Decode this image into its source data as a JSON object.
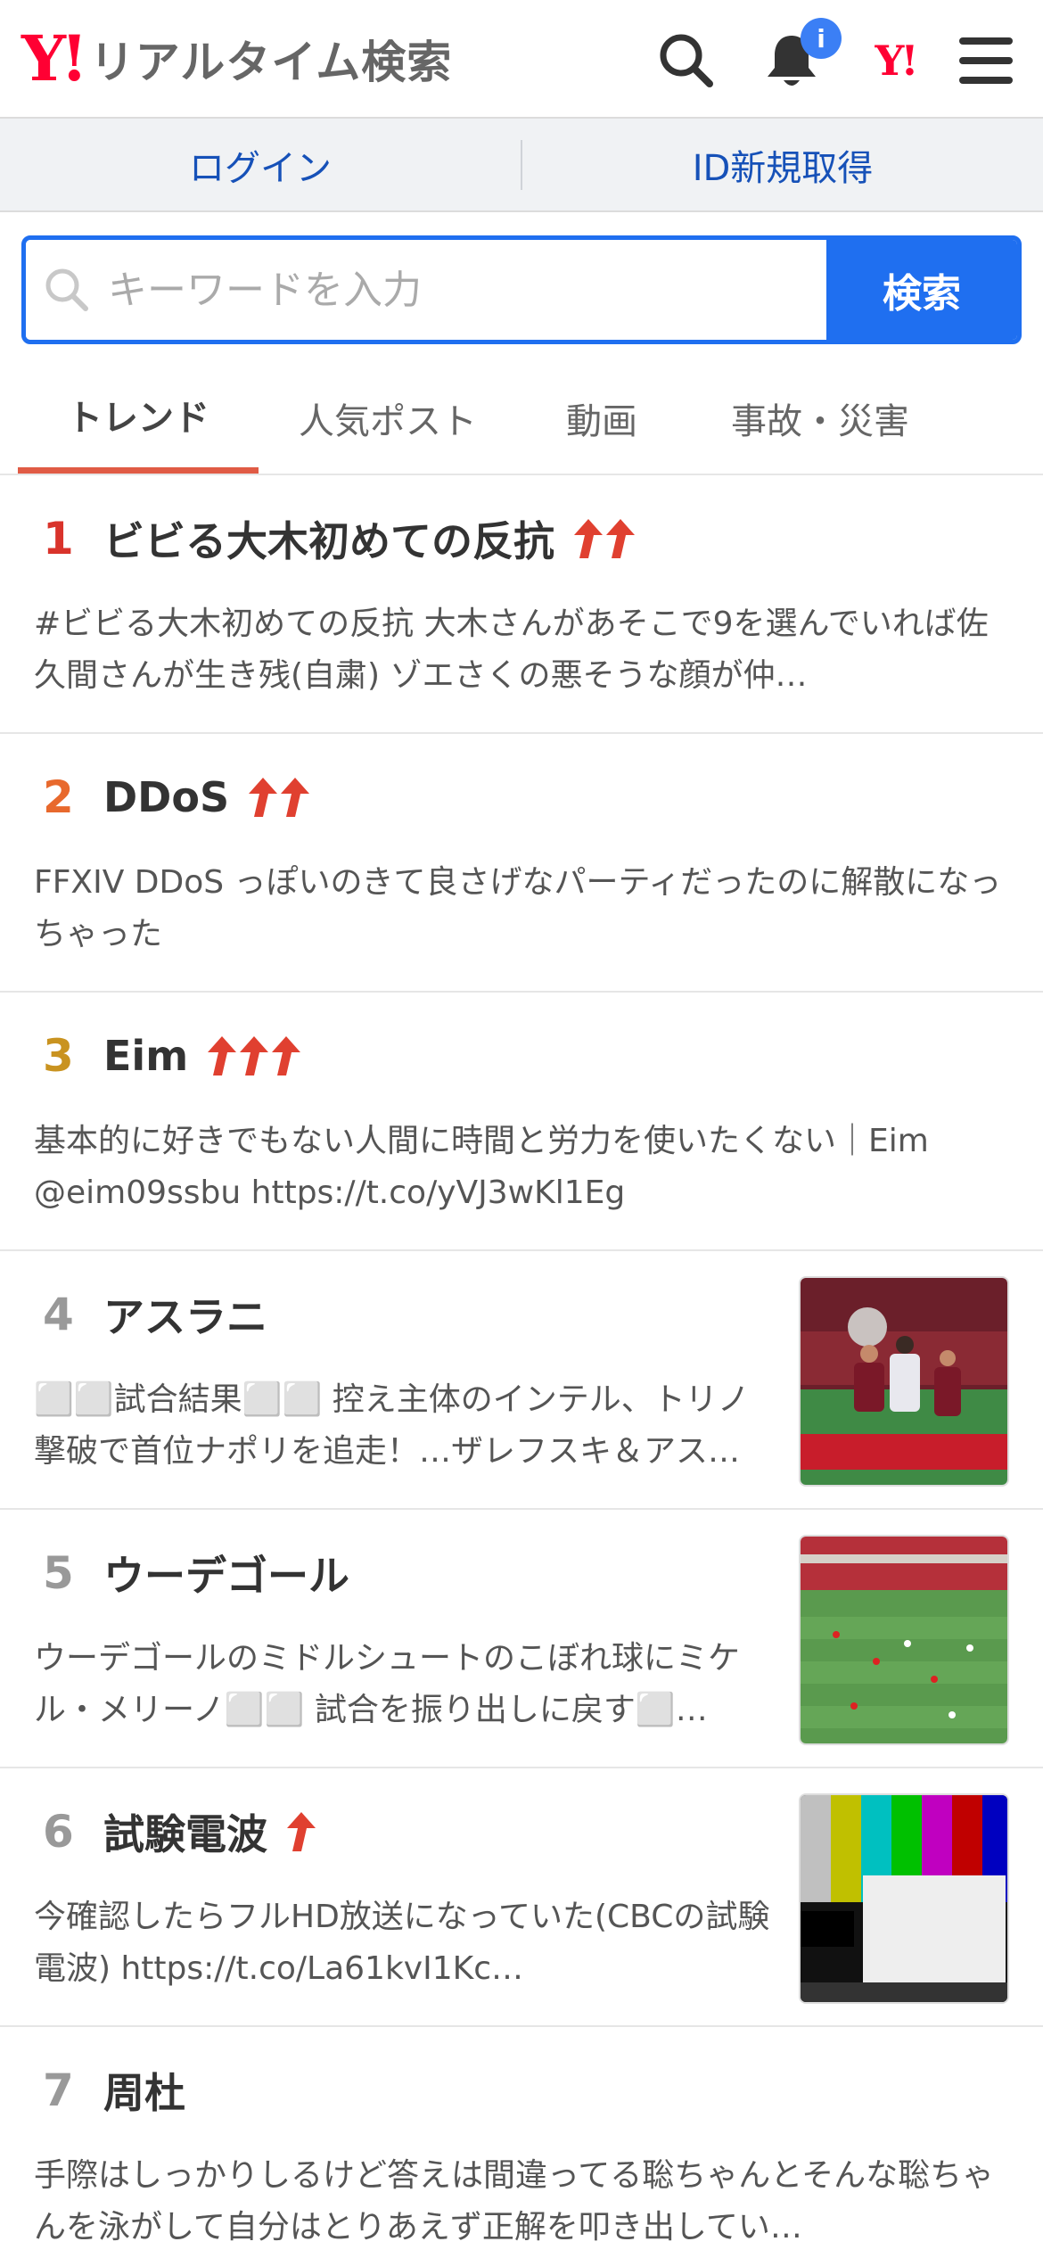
{
  "header": {
    "logo_mark": "Y!",
    "logo_text": "リアルタイム検索",
    "notification_badge": "i",
    "yjapan_mark": "Y!"
  },
  "login_bar": {
    "login": "ログイン",
    "register": "ID新規取得"
  },
  "search": {
    "placeholder": "キーワードを入力",
    "value": "",
    "submit_label": "検索"
  },
  "tabs": [
    {
      "label": "トレンド",
      "active": true
    },
    {
      "label": "人気ポスト",
      "active": false
    },
    {
      "label": "動画",
      "active": false
    },
    {
      "label": "事故・災害",
      "active": false
    }
  ],
  "colors": {
    "accent_blue": "#1f6ff0",
    "rank1": "#d9332b",
    "rank2": "#e8692d",
    "rank3": "#c99320",
    "rank_other": "#999999",
    "tab_underline": "#e05b45",
    "arrow": "#e04030"
  },
  "trends": [
    {
      "rank": "1",
      "title": "ビビる大木初めての反抗",
      "arrows": 2,
      "thumbnail": null,
      "snippet": "#ビビる大木初めての反抗 大木さんがあそこで9を選んでいれば佐久間さんが生き残(自粛) ゾエさくの悪そうな顔が仲…"
    },
    {
      "rank": "2",
      "title": "DDoS",
      "arrows": 2,
      "thumbnail": null,
      "snippet": "FFXIV DDoS っぽいのきて良さげなパーティだったのに解散になっちゃった"
    },
    {
      "rank": "3",
      "title": "Eim",
      "arrows": 3,
      "thumbnail": null,
      "snippet": "基本的に好きでもない人間に時間と労力を使いたくない｜Eim @eim09ssbu https://t.co/yVJ3wKl1Eg"
    },
    {
      "rank": "4",
      "title": "アスラニ",
      "arrows": 0,
      "thumbnail": "soccer-players",
      "snippet": "⬜⬜試合結果⬜⬜ 控え主体のインテル、トリノ撃破で首位ナポリを追走！…ザレフスキ＆アス…"
    },
    {
      "rank": "5",
      "title": "ウーデゴール",
      "arrows": 0,
      "thumbnail": "soccer-pitch",
      "snippet": "ウーデゴールのミドルシュートのこぼれ球にミケル・メリーノ⬜⬜ 試合を振り出しに戻す⬜…"
    },
    {
      "rank": "6",
      "title": "試験電波",
      "arrows": 1,
      "thumbnail": "test-pattern",
      "snippet": "今確認したらフルHD放送になっていた(CBCの試験電波) https://t.co/La61kvI1Kc…"
    },
    {
      "rank": "7",
      "title": "周杜",
      "arrows": 0,
      "thumbnail": null,
      "snippet": "手際はしっかりしるけど答えは間違ってる聡ちゃんとそんな聡ちゃんを泳がして自分はとりあえず正解を叩き出してい…"
    }
  ]
}
